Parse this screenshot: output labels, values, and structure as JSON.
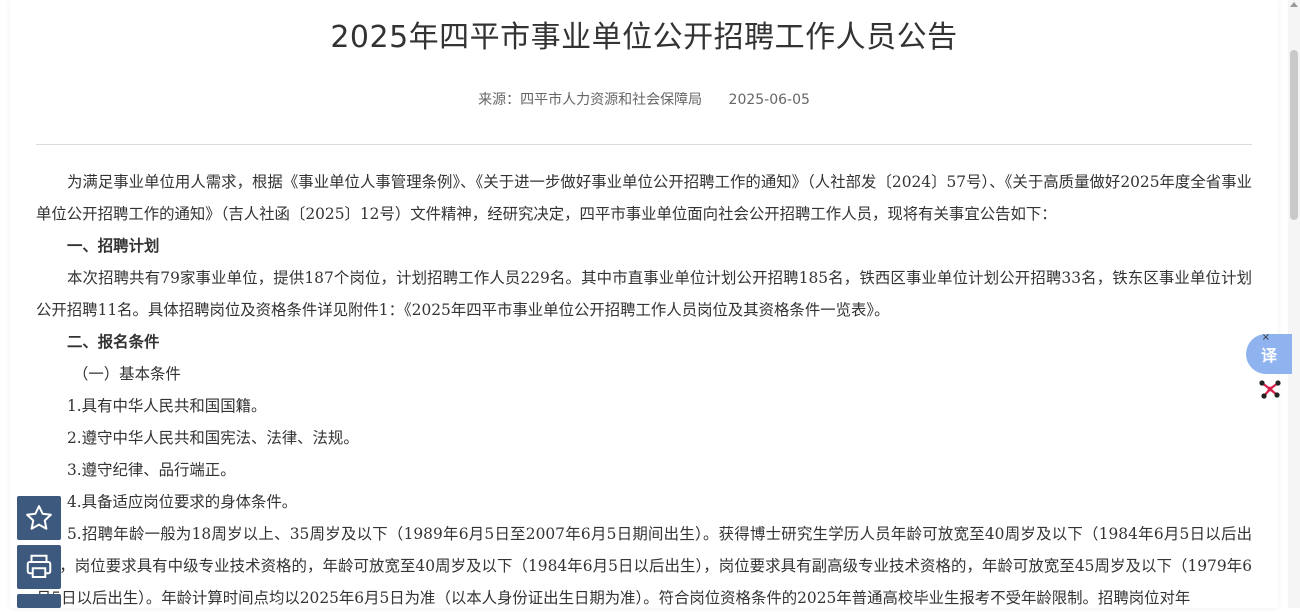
{
  "article": {
    "title": "2025年四平市事业单位公开招聘工作人员公告",
    "source": "来源：四平市人力资源和社会保障局",
    "date": "2025-06-05"
  },
  "content": {
    "intro": "为满足事业单位用人需求，根据《事业单位人事管理条例》、《关于进一步做好事业单位公开招聘工作的通知》（人社部发〔2024〕57号）、《关于高质量做好2025年度全省事业单位公开招聘工作的通知》（吉人社函〔2025〕12号）文件精神，经研究决定，四平市事业单位面向社会公开招聘工作人员，现将有关事宜公告如下：",
    "section1_heading": "一、招聘计划",
    "section1_text": "本次招聘共有79家事业单位，提供187个岗位，计划招聘工作人员229名。其中市直事业单位计划公开招聘185名，铁西区事业单位计划公开招聘33名，铁东区事业单位计划公开招聘11名。具体招聘岗位及资格条件详见附件1：《2025年四平市事业单位公开招聘工作人员岗位及其资格条件一览表》。",
    "section2_heading": "二、报名条件",
    "subsection1_heading": "（一）基本条件",
    "items": [
      "1.具有中华人民共和国国籍。",
      "2.遵守中华人民共和国宪法、法律、法规。",
      "3.遵守纪律、品行端正。",
      "4.具备适应岗位要求的身体条件。",
      "5.招聘年龄一般为18周岁以上、35周岁及以下（1989年6月5日至2007年6月5日期间出生）。获得博士研究生学历人员年龄可放宽至40周岁及以下（1984年6月5日以后出生），岗位要求具有中级专业技术资格的，年龄可放宽至40周岁及以下（1984年6月5日以后出生），岗位要求具有副高级专业技术资格的，年龄可放宽至45周岁及以下（1979年6月5日以后出生）。年龄计算时间点均以2025年6月5日为准（以本人身份证出生日期为准）。符合岗位资格条件的2025年普通高校毕业生报考不受年龄限制。招聘岗位对年"
    ]
  },
  "floating": {
    "favorite_icon": "star-icon",
    "print_icon": "printer-icon",
    "translate_label": "译",
    "translate_close": "×"
  }
}
